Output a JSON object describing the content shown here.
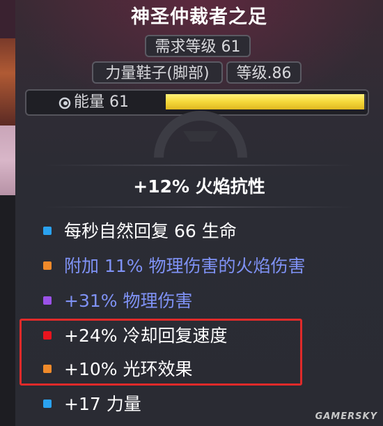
{
  "item": {
    "name": "神圣仲裁者之足",
    "required_level": "需求等级 61",
    "type": "力量鞋子(脚部)",
    "item_level": "等级.86",
    "energy_label": "能量 61",
    "energy_fill_fraction": 0.99,
    "implicit": "+12% 火焰抗性"
  },
  "affixes": [
    {
      "text": "每秒自然回复 66 生命",
      "dot_color": "#2aa2f0",
      "text_color": "#ffffff"
    },
    {
      "text": "附加 11% 物理伤害的火焰伤害",
      "dot_color": "#f08a2a",
      "text_color": "#7f92f5"
    },
    {
      "text": "+31% 物理伤害",
      "dot_color": "#9b52e8",
      "text_color": "#7f92f5"
    },
    {
      "text": "+24% 冷却回复速度",
      "dot_color": "#e8141e",
      "text_color": "#ffffff"
    },
    {
      "text": "+10% 光环效果",
      "dot_color": "#f08a2a",
      "text_color": "#ffffff"
    },
    {
      "text": "+17 力量",
      "dot_color": "#2aa2f0",
      "text_color": "#ffffff"
    }
  ],
  "colors": {
    "highlight_border": "#e02a2a",
    "energy_bar": "#f5d83a"
  },
  "watermark": "GAMERSKY"
}
